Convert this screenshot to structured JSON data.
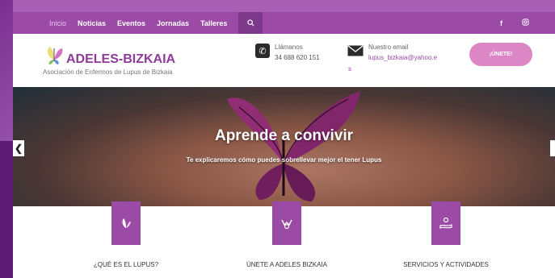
{
  "nav": {
    "items": [
      "Inicio",
      "Noticias",
      "Eventos",
      "Jornadas",
      "Talleres"
    ],
    "search_icon": "search-icon",
    "social": {
      "facebook": "f",
      "instagram": "instagram-icon"
    }
  },
  "header": {
    "brand": "ADELES-BIZKAIA",
    "subtitle": "Asociación de Enfermos de Lupus de Bizkaia",
    "phone_label": "Llámanos",
    "phone_number": "34 688 620 151",
    "email_label": "Nuestro email",
    "email_value": "lupus_bizkaia@yahoo.e",
    "email_tail": "s",
    "join_label": "¡ÚNETE!"
  },
  "hero": {
    "title": "Aprende a convivir",
    "subtitle": "Te explicaremos cómo puedes sobrellevar mejor el tener Lupus"
  },
  "features": [
    {
      "title": "¿QUÉ ES EL LUPUS?",
      "icon": "butterfly-icon"
    },
    {
      "title": "ÚNETE A ADELES BIZKAIA",
      "icon": "hands-icon"
    },
    {
      "title": "SERVICIOS Y ACTIVIDADES",
      "icon": "hand-care-icon"
    }
  ],
  "colors": {
    "brand": "#9b4aa6",
    "join": "#dc86c6"
  }
}
